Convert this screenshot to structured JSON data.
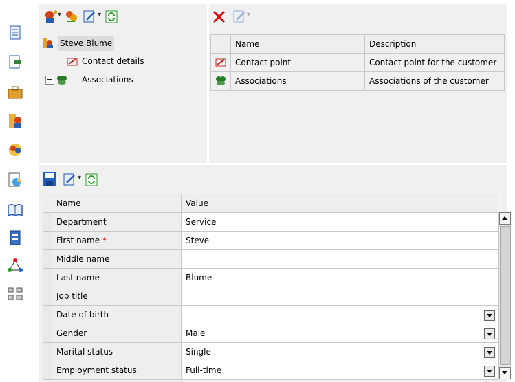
{
  "tree": {
    "root_label": "Steve Blume",
    "items": [
      {
        "label": "Contact details",
        "expander": ""
      },
      {
        "label": "Associations",
        "expander": "+"
      }
    ]
  },
  "relations_table": {
    "headers": [
      "Name",
      "Description"
    ],
    "rows": [
      {
        "name": "Contact point",
        "description": "Contact point for the customer",
        "icon": "contact-point-icon"
      },
      {
        "name": "Associations",
        "description": "Associations of the customer",
        "icon": "associations-icon"
      }
    ]
  },
  "properties": {
    "headers": [
      "Name",
      "Value"
    ],
    "required_marker": "*",
    "rows": [
      {
        "name": "Department",
        "value": "Service",
        "dropdown": false
      },
      {
        "name": "First name",
        "value": "Steve",
        "dropdown": false,
        "required": true
      },
      {
        "name": "Middle name",
        "value": "",
        "dropdown": false
      },
      {
        "name": "Last name",
        "value": "Blume",
        "dropdown": false
      },
      {
        "name": "Job title",
        "value": "",
        "dropdown": false
      },
      {
        "name": "Date of birth",
        "value": "",
        "dropdown": true
      },
      {
        "name": "Gender",
        "value": "Male",
        "dropdown": true
      },
      {
        "name": "Marital status",
        "value": "Single",
        "dropdown": true
      },
      {
        "name": "Employment status",
        "value": "Full-time",
        "dropdown": true
      }
    ]
  },
  "sidebar": {
    "icons": [
      "document-icon",
      "edit-document-icon",
      "briefcase-icon",
      "contacts-icon",
      "globe-people-icon",
      "chart-document-icon",
      "book-icon",
      "server-icon",
      "network-icon",
      "tree-structure-icon"
    ]
  },
  "colors": {
    "accent": "#1f5fbf",
    "delete": "#e00000",
    "refresh": "#2a9d2a",
    "grid_border": "#c9c9c9"
  }
}
